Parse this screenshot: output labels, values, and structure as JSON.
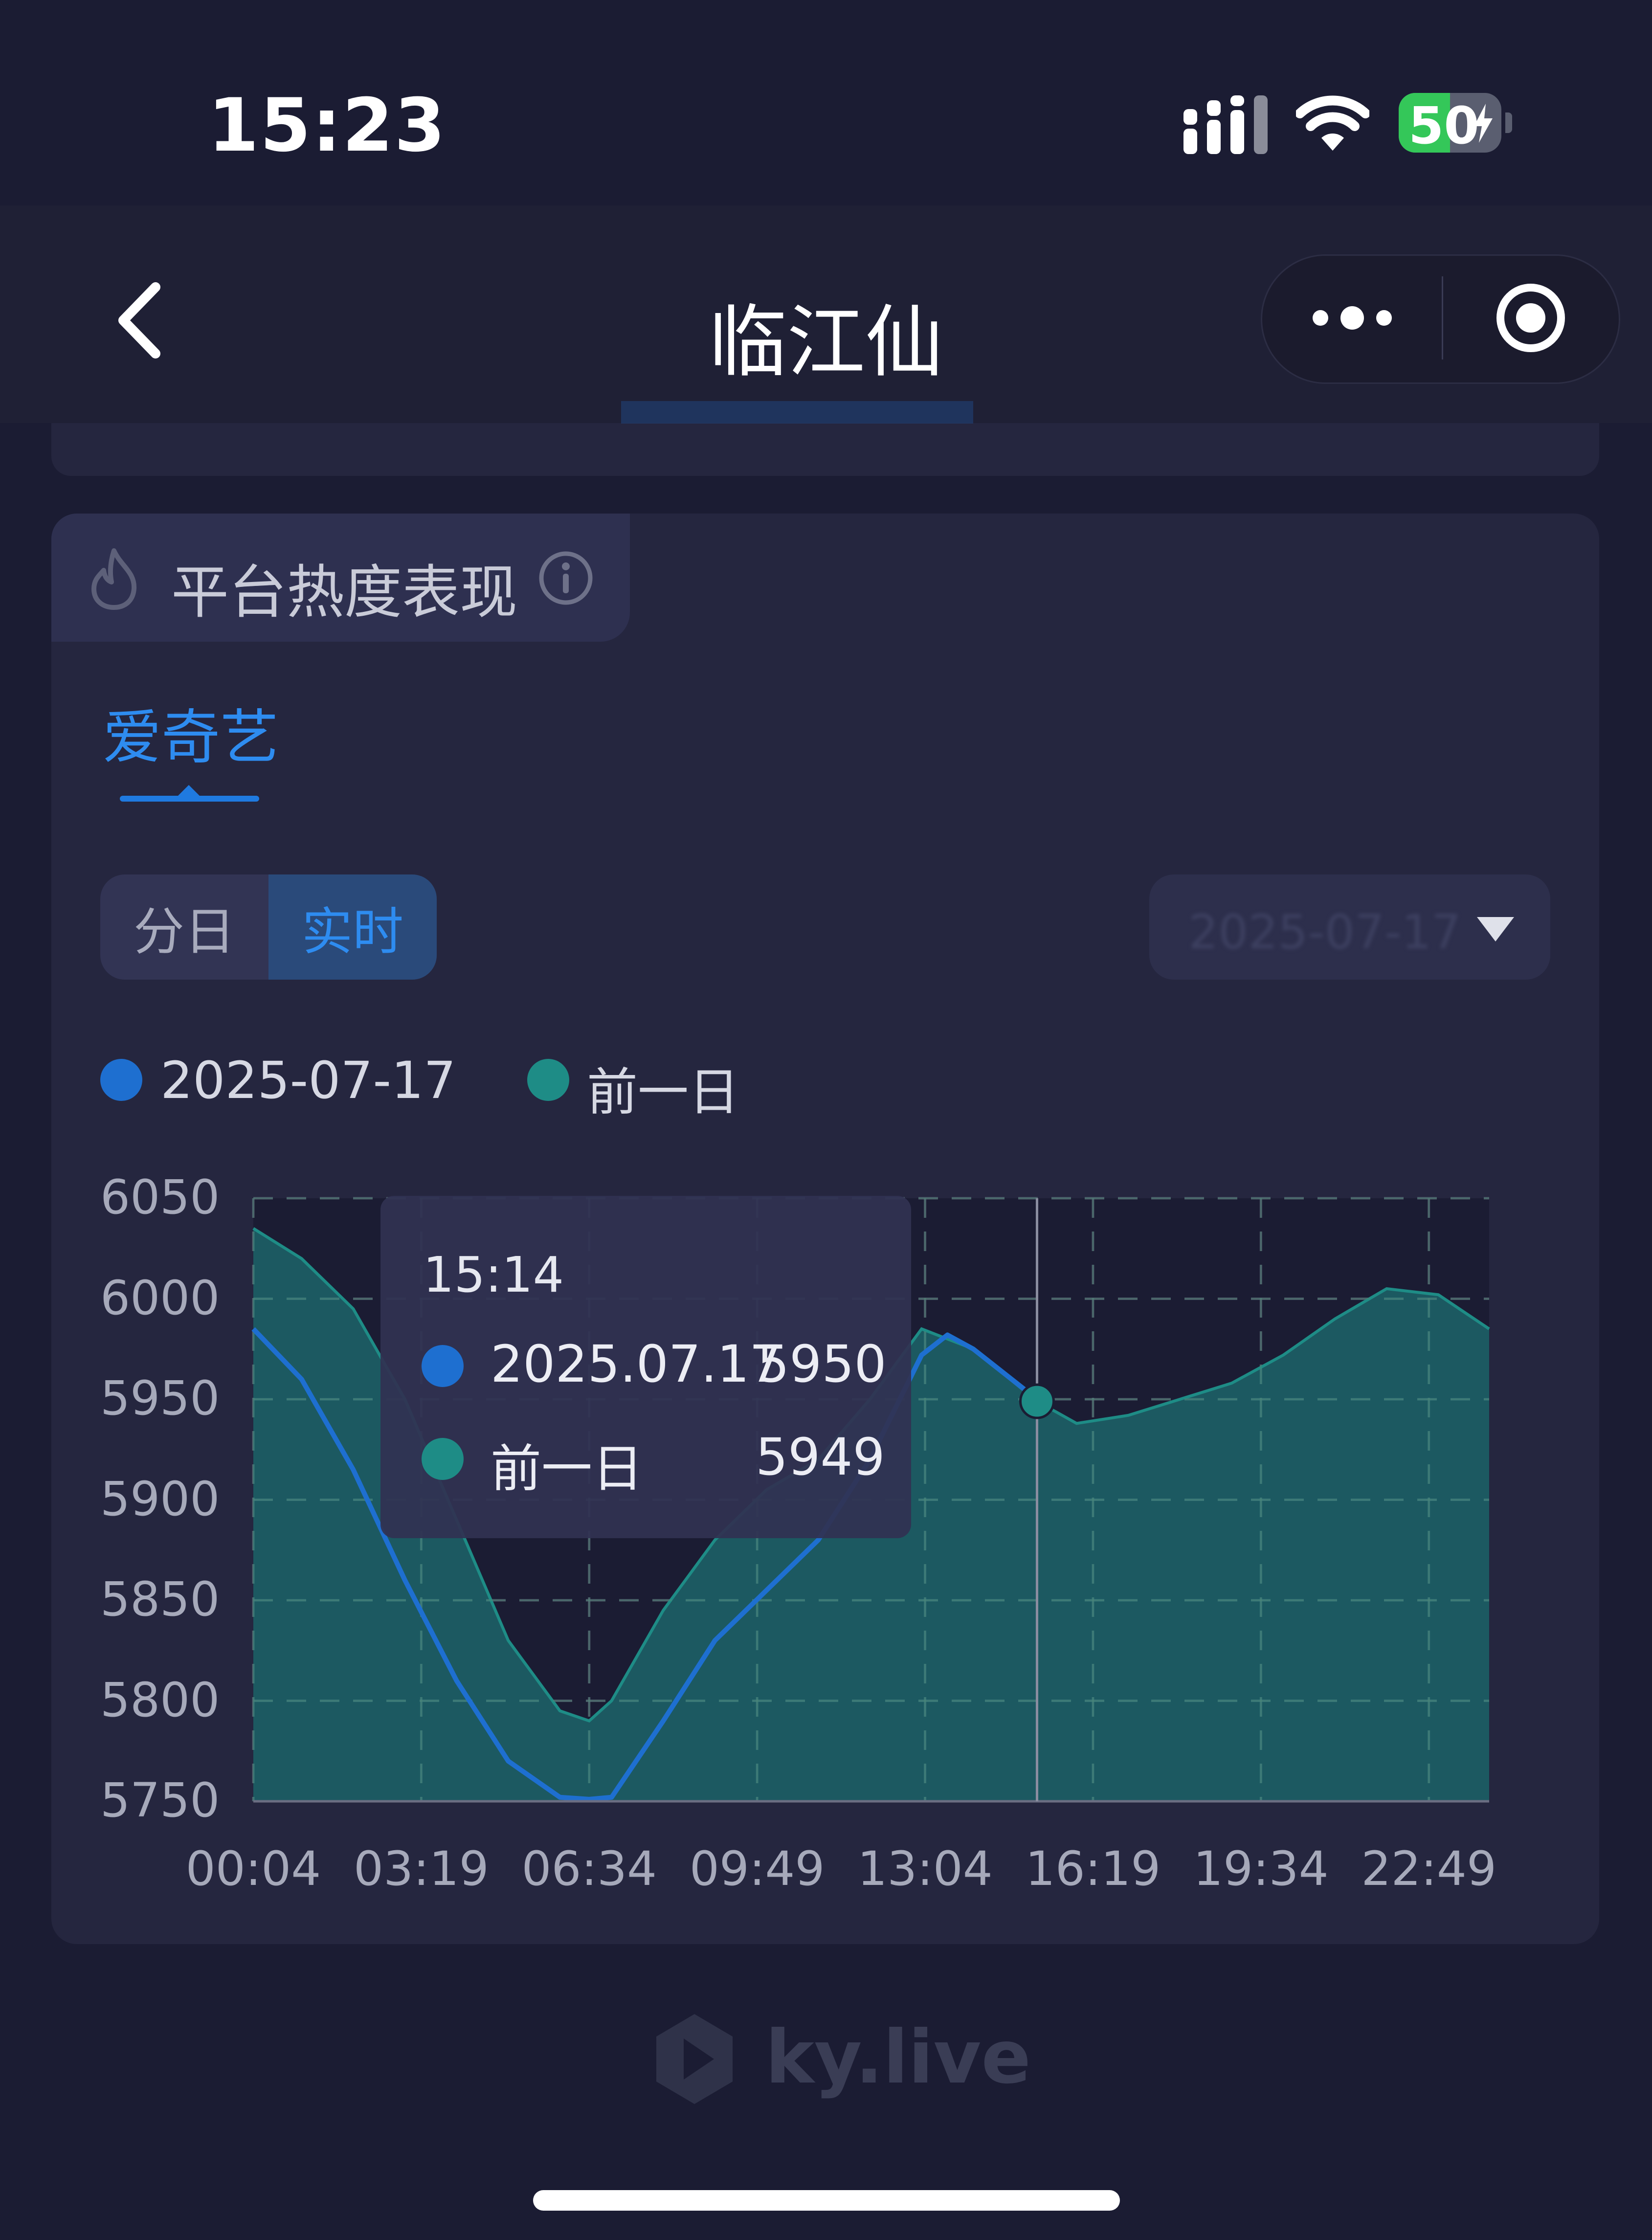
{
  "status_bar": {
    "time": "15:23",
    "battery_percent": 50,
    "battery_label": "50"
  },
  "nav": {
    "title": "临江仙"
  },
  "section": {
    "title": "平台热度表现"
  },
  "tabs": [
    {
      "label": "爱奇艺",
      "active": true
    }
  ],
  "segment": {
    "options": [
      "分日",
      "实时"
    ],
    "selected": "实时"
  },
  "date_select": {
    "value": "2025-07-17"
  },
  "legend": [
    {
      "label": "2025-07-17",
      "color": "#1e6fd0"
    },
    {
      "label": "前一日",
      "color": "#1e8c86"
    }
  ],
  "tooltip": {
    "time": "15:14",
    "rows": [
      {
        "label": "2025.07.17",
        "value": "5950",
        "color": "#1e6fd0"
      },
      {
        "label": "前一日",
        "value": "5949",
        "color": "#1e8c86"
      }
    ]
  },
  "watermark": {
    "text": "ky.live"
  },
  "chart_data": {
    "type": "area",
    "ylim": [
      5750,
      6050
    ],
    "y_ticks": [
      "6050",
      "6000",
      "5950",
      "5900",
      "5850",
      "5800",
      "5750"
    ],
    "x_tick_labels": [
      "00:04",
      "03:19",
      "06:34",
      "09:49",
      "13:04",
      "16:19",
      "19:34",
      "22:49"
    ],
    "grid": true,
    "legend_position": "top-left",
    "cursor_time": "15:14",
    "series": [
      {
        "name": "前一日",
        "style": "area",
        "color": "#1e8c86",
        "points": [
          [
            "00:04",
            6035
          ],
          [
            "01:00",
            6020
          ],
          [
            "02:00",
            5995
          ],
          [
            "03:00",
            5950
          ],
          [
            "04:00",
            5890
          ],
          [
            "05:00",
            5830
          ],
          [
            "06:00",
            5795
          ],
          [
            "06:34",
            5790
          ],
          [
            "07:00",
            5800
          ],
          [
            "08:00",
            5845
          ],
          [
            "09:00",
            5880
          ],
          [
            "10:00",
            5905
          ],
          [
            "11:00",
            5920
          ],
          [
            "12:00",
            5950
          ],
          [
            "13:00",
            5985
          ],
          [
            "14:00",
            5975
          ],
          [
            "15:14",
            5949
          ],
          [
            "16:00",
            5938
          ],
          [
            "17:00",
            5942
          ],
          [
            "18:00",
            5950
          ],
          [
            "19:00",
            5958
          ],
          [
            "20:00",
            5972
          ],
          [
            "21:00",
            5990
          ],
          [
            "22:00",
            6005
          ],
          [
            "23:00",
            6002
          ],
          [
            "23:59",
            5985
          ]
        ]
      },
      {
        "name": "2025-07-17",
        "style": "line",
        "color": "#1e6fd0",
        "points": [
          [
            "00:04",
            5985
          ],
          [
            "01:00",
            5960
          ],
          [
            "02:00",
            5915
          ],
          [
            "03:00",
            5860
          ],
          [
            "04:00",
            5810
          ],
          [
            "05:00",
            5770
          ],
          [
            "06:00",
            5752
          ],
          [
            "06:34",
            5751
          ],
          [
            "07:00",
            5752
          ],
          [
            "08:00",
            5790
          ],
          [
            "09:00",
            5830
          ],
          [
            "10:00",
            5855
          ],
          [
            "11:00",
            5880
          ],
          [
            "12:00",
            5920
          ],
          [
            "13:00",
            5972
          ],
          [
            "13:30",
            5982
          ],
          [
            "14:00",
            5975
          ],
          [
            "15:14",
            5950
          ]
        ]
      }
    ]
  }
}
